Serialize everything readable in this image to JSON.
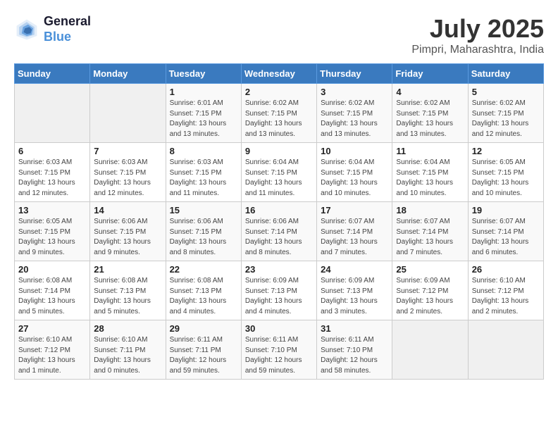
{
  "logo": {
    "line1": "General",
    "line2": "Blue"
  },
  "title": "July 2025",
  "location": "Pimpri, Maharashtra, India",
  "weekdays": [
    "Sunday",
    "Monday",
    "Tuesday",
    "Wednesday",
    "Thursday",
    "Friday",
    "Saturday"
  ],
  "weeks": [
    [
      {
        "day": "",
        "info": ""
      },
      {
        "day": "",
        "info": ""
      },
      {
        "day": "1",
        "info": "Sunrise: 6:01 AM\nSunset: 7:15 PM\nDaylight: 13 hours\nand 13 minutes."
      },
      {
        "day": "2",
        "info": "Sunrise: 6:02 AM\nSunset: 7:15 PM\nDaylight: 13 hours\nand 13 minutes."
      },
      {
        "day": "3",
        "info": "Sunrise: 6:02 AM\nSunset: 7:15 PM\nDaylight: 13 hours\nand 13 minutes."
      },
      {
        "day": "4",
        "info": "Sunrise: 6:02 AM\nSunset: 7:15 PM\nDaylight: 13 hours\nand 13 minutes."
      },
      {
        "day": "5",
        "info": "Sunrise: 6:02 AM\nSunset: 7:15 PM\nDaylight: 13 hours\nand 12 minutes."
      }
    ],
    [
      {
        "day": "6",
        "info": "Sunrise: 6:03 AM\nSunset: 7:15 PM\nDaylight: 13 hours\nand 12 minutes."
      },
      {
        "day": "7",
        "info": "Sunrise: 6:03 AM\nSunset: 7:15 PM\nDaylight: 13 hours\nand 12 minutes."
      },
      {
        "day": "8",
        "info": "Sunrise: 6:03 AM\nSunset: 7:15 PM\nDaylight: 13 hours\nand 11 minutes."
      },
      {
        "day": "9",
        "info": "Sunrise: 6:04 AM\nSunset: 7:15 PM\nDaylight: 13 hours\nand 11 minutes."
      },
      {
        "day": "10",
        "info": "Sunrise: 6:04 AM\nSunset: 7:15 PM\nDaylight: 13 hours\nand 10 minutes."
      },
      {
        "day": "11",
        "info": "Sunrise: 6:04 AM\nSunset: 7:15 PM\nDaylight: 13 hours\nand 10 minutes."
      },
      {
        "day": "12",
        "info": "Sunrise: 6:05 AM\nSunset: 7:15 PM\nDaylight: 13 hours\nand 10 minutes."
      }
    ],
    [
      {
        "day": "13",
        "info": "Sunrise: 6:05 AM\nSunset: 7:15 PM\nDaylight: 13 hours\nand 9 minutes."
      },
      {
        "day": "14",
        "info": "Sunrise: 6:06 AM\nSunset: 7:15 PM\nDaylight: 13 hours\nand 9 minutes."
      },
      {
        "day": "15",
        "info": "Sunrise: 6:06 AM\nSunset: 7:15 PM\nDaylight: 13 hours\nand 8 minutes."
      },
      {
        "day": "16",
        "info": "Sunrise: 6:06 AM\nSunset: 7:14 PM\nDaylight: 13 hours\nand 8 minutes."
      },
      {
        "day": "17",
        "info": "Sunrise: 6:07 AM\nSunset: 7:14 PM\nDaylight: 13 hours\nand 7 minutes."
      },
      {
        "day": "18",
        "info": "Sunrise: 6:07 AM\nSunset: 7:14 PM\nDaylight: 13 hours\nand 7 minutes."
      },
      {
        "day": "19",
        "info": "Sunrise: 6:07 AM\nSunset: 7:14 PM\nDaylight: 13 hours\nand 6 minutes."
      }
    ],
    [
      {
        "day": "20",
        "info": "Sunrise: 6:08 AM\nSunset: 7:14 PM\nDaylight: 13 hours\nand 5 minutes."
      },
      {
        "day": "21",
        "info": "Sunrise: 6:08 AM\nSunset: 7:13 PM\nDaylight: 13 hours\nand 5 minutes."
      },
      {
        "day": "22",
        "info": "Sunrise: 6:08 AM\nSunset: 7:13 PM\nDaylight: 13 hours\nand 4 minutes."
      },
      {
        "day": "23",
        "info": "Sunrise: 6:09 AM\nSunset: 7:13 PM\nDaylight: 13 hours\nand 4 minutes."
      },
      {
        "day": "24",
        "info": "Sunrise: 6:09 AM\nSunset: 7:13 PM\nDaylight: 13 hours\nand 3 minutes."
      },
      {
        "day": "25",
        "info": "Sunrise: 6:09 AM\nSunset: 7:12 PM\nDaylight: 13 hours\nand 2 minutes."
      },
      {
        "day": "26",
        "info": "Sunrise: 6:10 AM\nSunset: 7:12 PM\nDaylight: 13 hours\nand 2 minutes."
      }
    ],
    [
      {
        "day": "27",
        "info": "Sunrise: 6:10 AM\nSunset: 7:12 PM\nDaylight: 13 hours\nand 1 minute."
      },
      {
        "day": "28",
        "info": "Sunrise: 6:10 AM\nSunset: 7:11 PM\nDaylight: 13 hours\nand 0 minutes."
      },
      {
        "day": "29",
        "info": "Sunrise: 6:11 AM\nSunset: 7:11 PM\nDaylight: 12 hours\nand 59 minutes."
      },
      {
        "day": "30",
        "info": "Sunrise: 6:11 AM\nSunset: 7:10 PM\nDaylight: 12 hours\nand 59 minutes."
      },
      {
        "day": "31",
        "info": "Sunrise: 6:11 AM\nSunset: 7:10 PM\nDaylight: 12 hours\nand 58 minutes."
      },
      {
        "day": "",
        "info": ""
      },
      {
        "day": "",
        "info": ""
      }
    ]
  ]
}
